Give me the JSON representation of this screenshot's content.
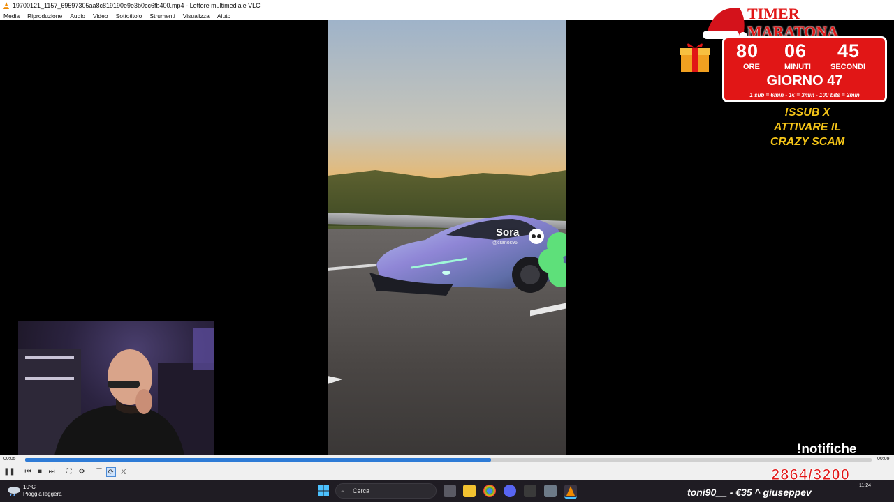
{
  "window": {
    "title": "19700121_1157_69597305aa8c819190e9e3b0cc6fb400.mp4 - Lettore multimediale VLC"
  },
  "menu": [
    "Media",
    "Riproduzione",
    "Audio",
    "Video",
    "Sottotitolo",
    "Strumenti",
    "Visualizza",
    "Aiuto"
  ],
  "video": {
    "watermark_title": "Sora",
    "watermark_handle": "@cranos96"
  },
  "overlay": {
    "timer_title": "TIMER MARATONA",
    "hours": "80",
    "minutes": "06",
    "seconds": "45",
    "hours_label": "ORE",
    "minutes_label": "MINUTI",
    "seconds_label": "SECONDI",
    "day": "GIORNO 47",
    "rates": "1 sub = 6min - 1€ = 3min - 100 bits = 2min",
    "crazy_line1": "!SSUB X",
    "crazy_line2": "ATTIVARE IL",
    "crazy_line3": "CRAZY SCAM",
    "notifiche": "!notifiche",
    "goal": "2864/3200",
    "ticker": "toni90__ - €35 ^ giuseppev"
  },
  "player": {
    "time_elapsed": "00:05",
    "time_total": "00:09",
    "progress": 0.55
  },
  "taskbar": {
    "temp": "10°C",
    "weather": "Pioggia leggera",
    "search_placeholder": "Cerca",
    "time": "11:24"
  },
  "colors": {
    "accent": "#2e7bd6",
    "timer_red": "#e11616",
    "crazy_yellow": "#f5c518"
  }
}
